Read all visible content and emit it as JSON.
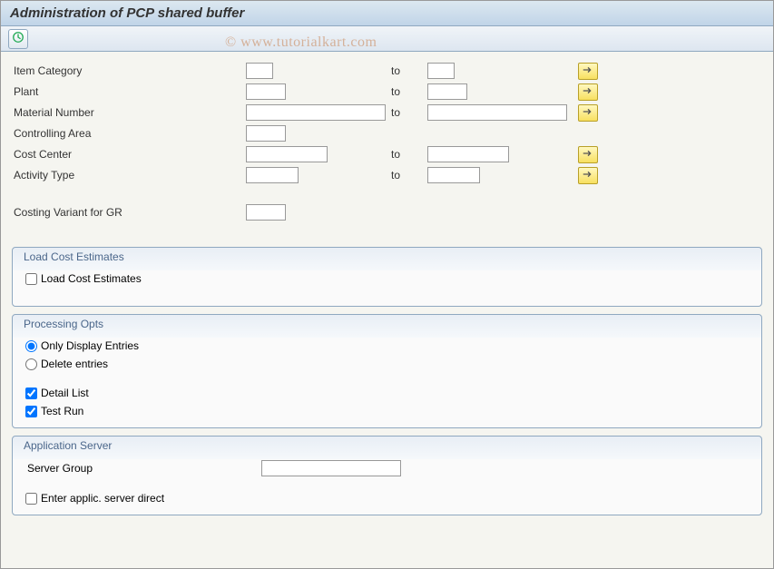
{
  "title": "Administration of PCP shared buffer",
  "watermark": "© www.tutorialkart.com",
  "labels": {
    "item_category": "Item Category",
    "plant": "Plant",
    "material_number": "Material Number",
    "controlling_area": "Controlling Area",
    "cost_center": "Cost Center",
    "activity_type": "Activity Type",
    "costing_variant": "Costing Variant for GR",
    "to": "to"
  },
  "values": {
    "item_category_from": "",
    "item_category_to": "",
    "plant_from": "",
    "plant_to": "",
    "material_from": "",
    "material_to": "",
    "controlling_area": "",
    "cost_center_from": "",
    "cost_center_to": "",
    "activity_type_from": "",
    "activity_type_to": "",
    "costing_variant": "",
    "server_group": ""
  },
  "groups": {
    "load_estimates": {
      "title": "Load Cost Estimates",
      "checkbox_label": "Load Cost Estimates",
      "checked": false
    },
    "processing": {
      "title": "Processing Opts",
      "radio_display": "Only Display Entries",
      "radio_delete": "Delete entries",
      "selected": "display",
      "detail_list_label": "Detail List",
      "detail_list_checked": true,
      "test_run_label": "Test Run",
      "test_run_checked": true
    },
    "app_server": {
      "title": "Application Server",
      "server_group_label": "Server Group",
      "enter_direct_label": "Enter applic. server direct",
      "enter_direct_checked": false
    }
  }
}
